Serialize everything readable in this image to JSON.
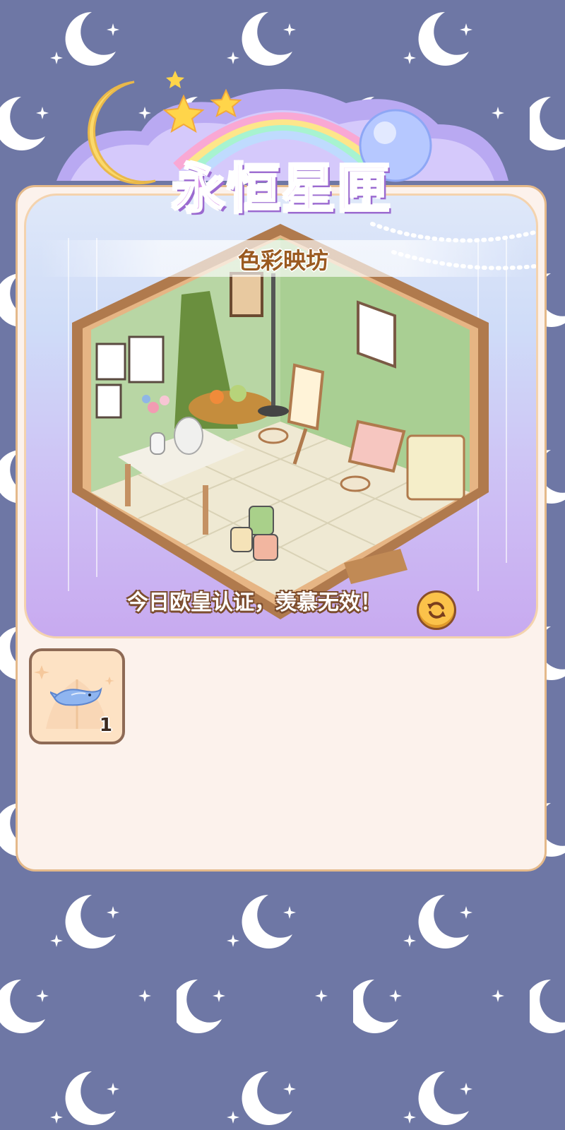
{
  "header": {
    "title": "永恒星匣"
  },
  "room": {
    "name": "色彩映坊",
    "slogan": "今日欧皇认证，羡慕无效！"
  },
  "inventory": {
    "items": [
      {
        "icon": "blue-whale-icon",
        "count": "1"
      }
    ]
  },
  "colors": {
    "background": "#6e77a5",
    "panel": "#fcf2ec",
    "panel_border": "#e4b98a",
    "title_fill": "#d58de8",
    "room_name": "#9a5a20",
    "refresh_button": "#fbc24a"
  }
}
